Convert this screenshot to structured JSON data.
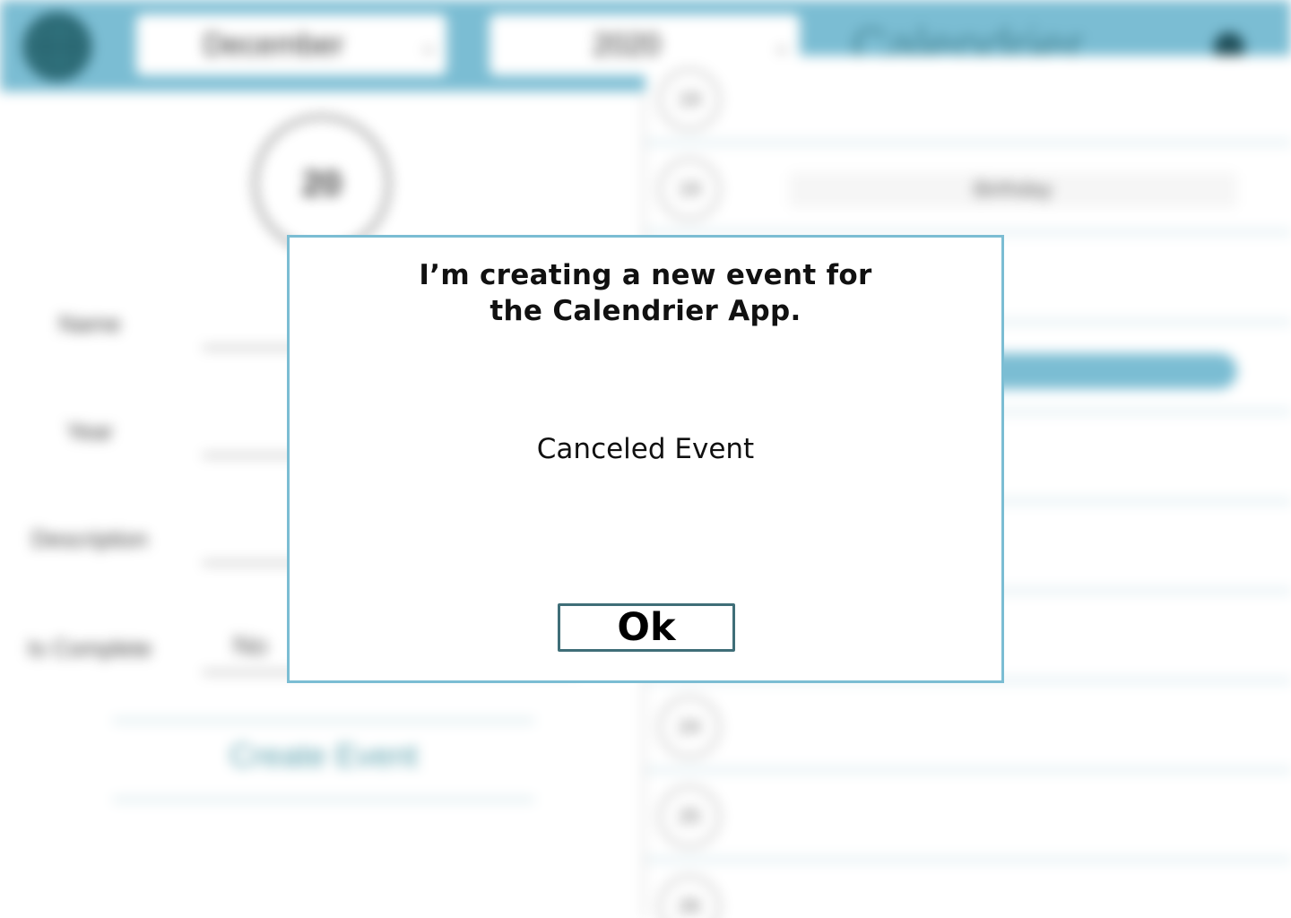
{
  "topbar": {
    "globe_icon": "globe-icon",
    "month_value": "December",
    "year_value": "2020",
    "chevron_icon": "chevron-down-icon",
    "app_title": "Calendrier",
    "menu_icon": "menu-dot-icon"
  },
  "left_pane": {
    "selected_day": "20",
    "fields": [
      {
        "label": "Name",
        "value": ""
      },
      {
        "label": "Year",
        "value": ""
      },
      {
        "label": "Description",
        "value": ""
      },
      {
        "label": "Is Complete",
        "value": "No"
      }
    ],
    "create_button": "Create Event"
  },
  "right_pane": {
    "rows": [
      {
        "day": "19",
        "chip": ""
      },
      {
        "day": "19",
        "chip": "Birthday"
      },
      {
        "day": "",
        "chip": ""
      },
      {
        "day": "",
        "chip": ""
      },
      {
        "day": "",
        "chip": ""
      },
      {
        "day": "",
        "chip": ""
      },
      {
        "day": "",
        "chip": ""
      },
      {
        "day": "24",
        "chip": ""
      },
      {
        "day": "25",
        "chip": ""
      },
      {
        "day": "26",
        "chip": ""
      }
    ]
  },
  "modal": {
    "title": "I’m creating a new event for\nthe Calendrier App.",
    "message": "Canceled Event",
    "ok_label": "Ok",
    "border_color": "#7bbdd3"
  },
  "colors": {
    "accent": "#7bbdd3",
    "button_border": "#3f6e78"
  }
}
